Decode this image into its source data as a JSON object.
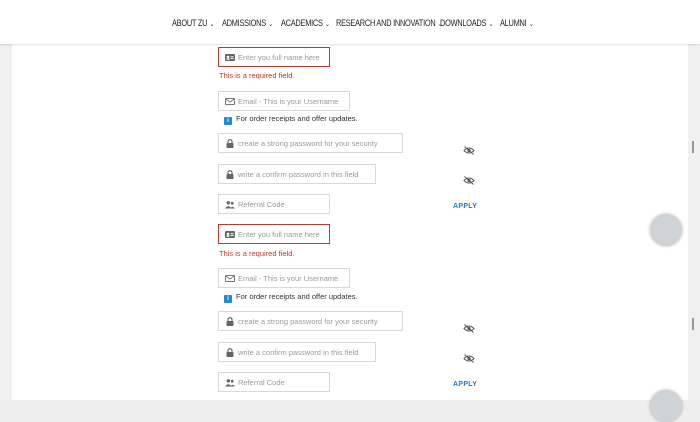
{
  "nav": {
    "items": [
      {
        "label": "ABOUT ZU"
      },
      {
        "label": "ADMISSIONS"
      },
      {
        "label": "ACADEMICS"
      },
      {
        "label": "RESEARCH AND INNOVATION"
      },
      {
        "label": "DOWNLOADS"
      },
      {
        "label": "ALUMNI"
      }
    ],
    "chevron": "⌄"
  },
  "forms": [
    {
      "fullname_placeholder": "Enter you full name here",
      "fullname_error": "This is a required field.",
      "email_placeholder": "Email - This is your Username",
      "email_note": "For order receipts and offer updates.",
      "info_badge": "i",
      "password_placeholder": "create a strong password for your security",
      "confirm_placeholder": "write a confirm password in this field",
      "referral_placeholder": "Referral Code",
      "apply_label": "APPLY"
    },
    {
      "fullname_placeholder": "Enter you full name here",
      "fullname_error": "This is a required field.",
      "email_placeholder": "Email - This is your Username",
      "email_note": "For order receipts and offer updates.",
      "info_badge": "i",
      "password_placeholder": "create a strong password for your security",
      "confirm_placeholder": "write a confirm password in this field",
      "referral_placeholder": "Referral Code",
      "apply_label": "APPLY"
    }
  ],
  "colors": {
    "error": "#c0392b",
    "accent": "#1e78c8",
    "info": "#1e8bd0"
  },
  "icons": {
    "fullname": "id-card-icon",
    "email": "envelope-icon",
    "password": "lock-icon",
    "confirm": "lock-icon",
    "referral": "users-icon",
    "toggle": "eye-slash-icon"
  }
}
